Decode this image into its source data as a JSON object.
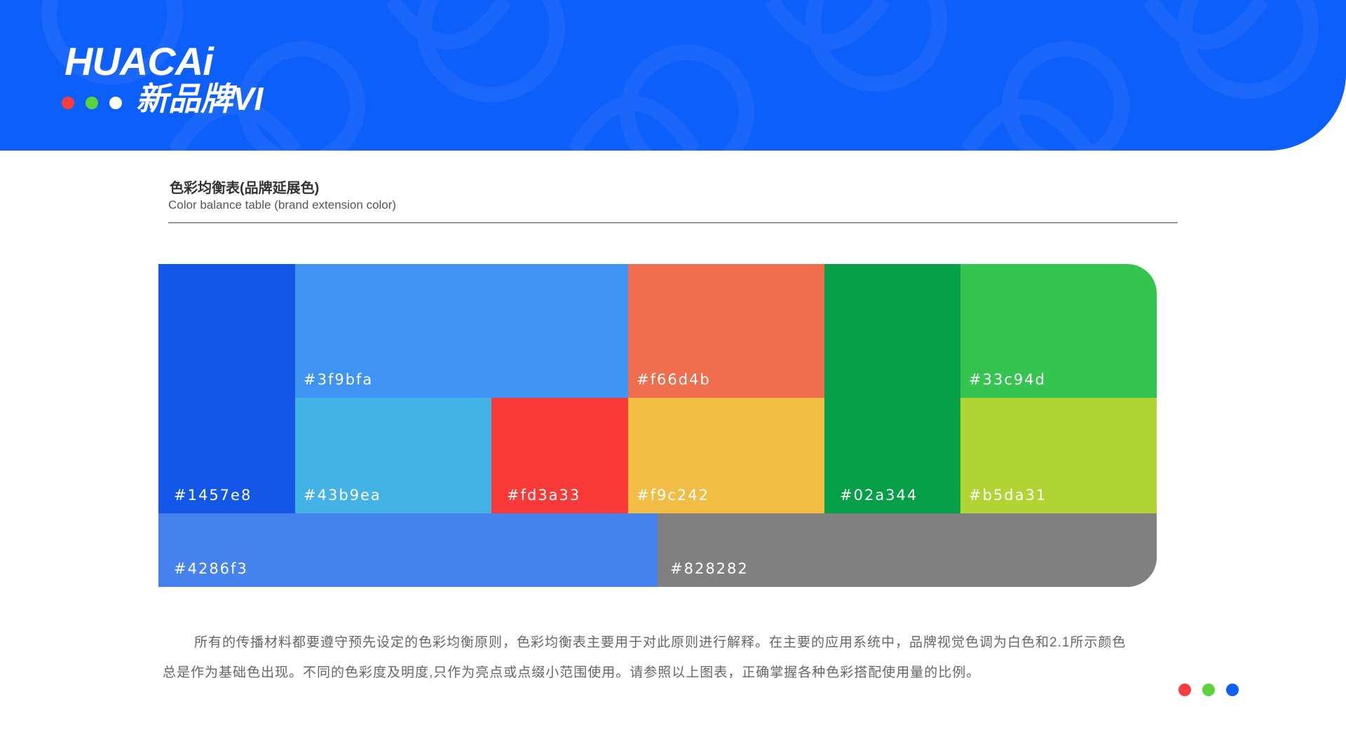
{
  "header": {
    "logo_text": "HUACAi",
    "subtitle": "新品牌VI",
    "background_color": "#0d5ffb",
    "dot_colors": [
      "#f73d3d",
      "#5bd33c",
      "#ffffff"
    ]
  },
  "section": {
    "title": "色彩均衡表(品牌延展色)",
    "subtitle": "Color balance table (brand extension color)"
  },
  "palette": {
    "swatches": [
      {
        "label": "#1457e8",
        "color": "#1457e8"
      },
      {
        "label": "#3f9bfa",
        "color": "#3f94f3"
      },
      {
        "label": "#43b9ea",
        "color": "#43b2e4"
      },
      {
        "label": "#fd3a33",
        "color": "#f73a37"
      },
      {
        "label": "#f66d4b",
        "color": "#ee6e4e"
      },
      {
        "label": "#f9c242",
        "color": "#f1bd45"
      },
      {
        "label": "#02a344",
        "color": "#049f46"
      },
      {
        "label": "#33c94d",
        "color": "#34c44f"
      },
      {
        "label": "#b5da31",
        "color": "#afd433"
      },
      {
        "label": "#4286f3",
        "color": "#4582ed"
      },
      {
        "label": "#828282",
        "color": "#808080"
      }
    ]
  },
  "description": "所有的传播材料都要遵守预先设定的色彩均衡原则，色彩均衡表主要用于对此原则进行解释。在主要的应用系统中，品牌视觉色调为白色和2.1所示颜色总是作为基础色出现。不同的色彩度及明度,只作为亮点或点缀小范围使用。请参照以上图表，正确掌握各种色彩搭配使用量的比例。",
  "footer": {
    "dot_colors": [
      "#f73d3d",
      "#5bd33c",
      "#0d5ffb"
    ]
  }
}
